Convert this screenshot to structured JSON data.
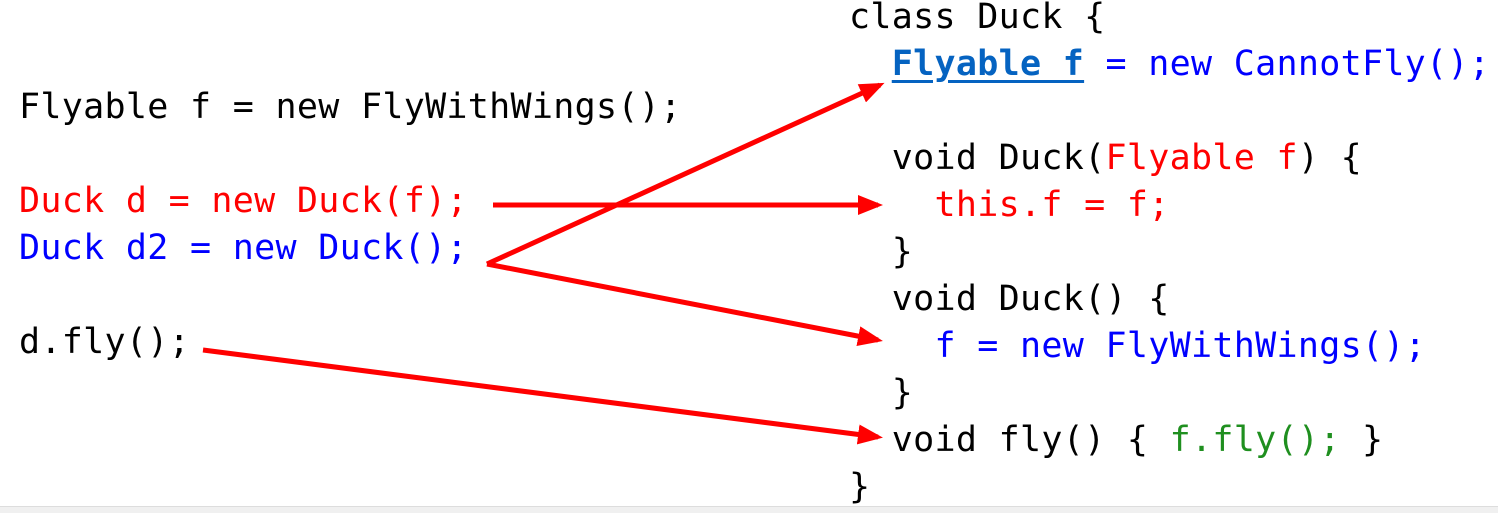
{
  "left_code": {
    "line1": "Flyable f = new FlyWithWings();",
    "line2": "Duck d = new Duck(f);",
    "line3": "Duck d2 = new Duck();",
    "line4": "d.fly();"
  },
  "right_code": {
    "class_decl": "class Duck {",
    "field_decl": "Flyable f",
    "field_init": " = new CannotFly();",
    "ctor1_sig_a": "void Duck(",
    "ctor1_param": "Flyable f",
    "ctor1_sig_b": ") {",
    "ctor1_body": "this.f = f;",
    "ctor1_close": "}",
    "ctor2_sig": "void Duck() {",
    "ctor2_body": "f = new FlyWithWings();",
    "ctor2_close": "}",
    "fly_sig": "void fly() { ",
    "fly_body": "f.fly();",
    "fly_close": " }",
    "class_close": "}"
  },
  "colors": {
    "arrow": "#ff0000",
    "red_code": "#ff0000",
    "blue_code": "#0000ff",
    "green_code": "#1f8f1f",
    "link_code": "#0563c1"
  }
}
